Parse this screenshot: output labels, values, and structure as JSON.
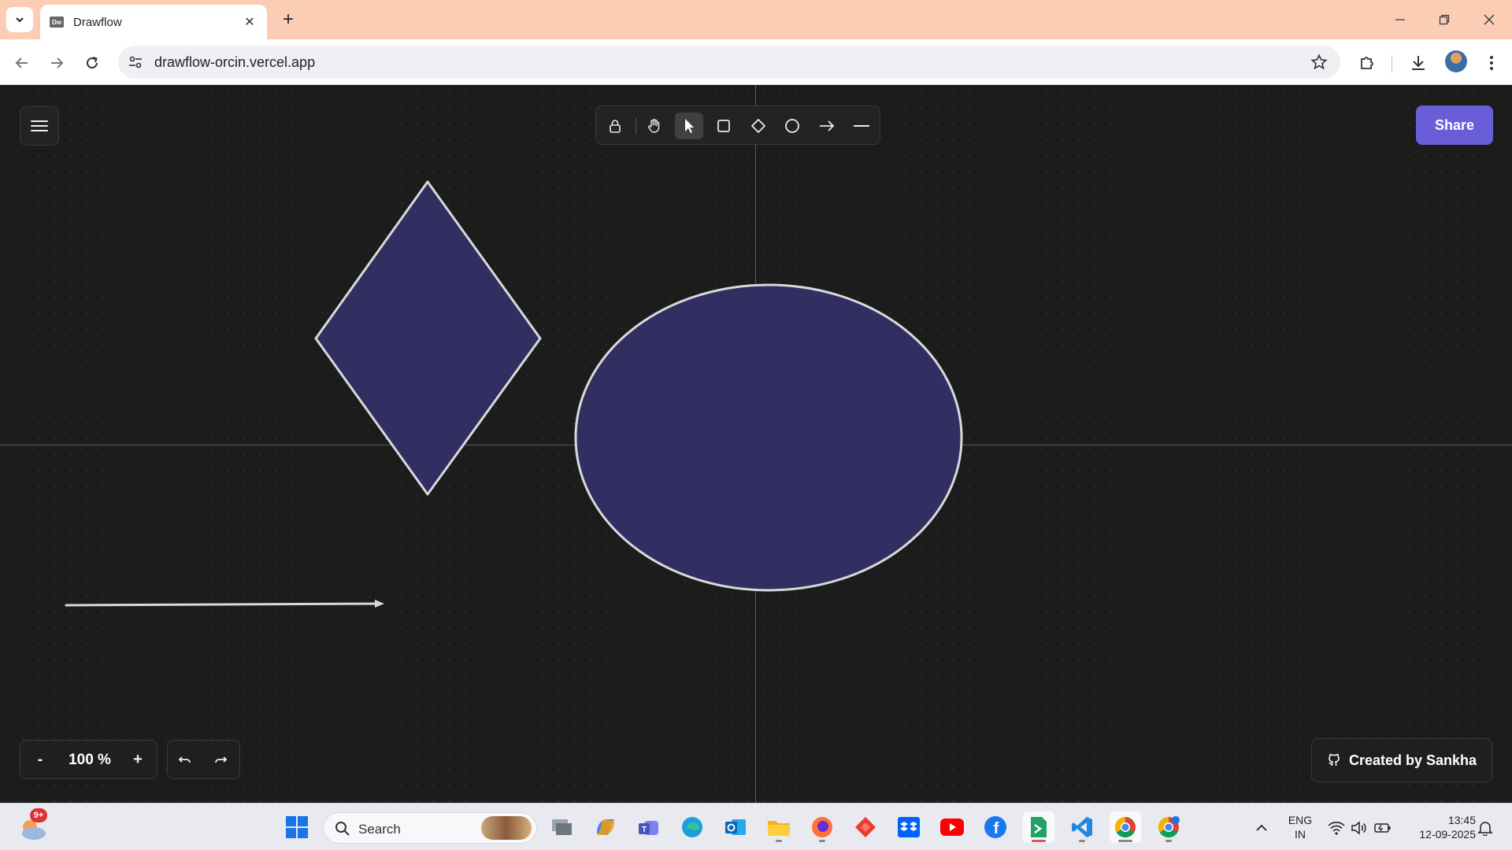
{
  "browser": {
    "tab_title": "Drawflow",
    "url": "drawflow-orcin.vercel.app",
    "favicon_label": "Dw"
  },
  "app": {
    "share_label": "Share",
    "zoom_level": "100 %",
    "zoom_out_label": "-",
    "zoom_in_label": "+",
    "credit_label": "Created by Sankha",
    "accent_color": "#6a5ed8",
    "shape_fill": "#312f62",
    "shape_stroke": "#d9d9d9",
    "tools": [
      {
        "name": "lock-tool",
        "icon": "lock-icon",
        "active": false
      },
      {
        "name": "hand-tool",
        "icon": "hand-icon",
        "active": false
      },
      {
        "name": "select-tool",
        "icon": "pointer-icon",
        "active": true
      },
      {
        "name": "rectangle-tool",
        "icon": "rectangle-icon",
        "active": false
      },
      {
        "name": "diamond-tool",
        "icon": "diamond-icon",
        "active": false
      },
      {
        "name": "ellipse-tool",
        "icon": "ellipse-icon",
        "active": false
      },
      {
        "name": "arrow-tool",
        "icon": "arrow-icon",
        "active": false
      },
      {
        "name": "line-tool",
        "icon": "line-icon",
        "active": false
      }
    ]
  },
  "taskbar": {
    "search_label": "Search",
    "weather_badge": "9+",
    "language": "ENG",
    "region": "IN",
    "time": "13:45",
    "date": "12-09-2025"
  }
}
